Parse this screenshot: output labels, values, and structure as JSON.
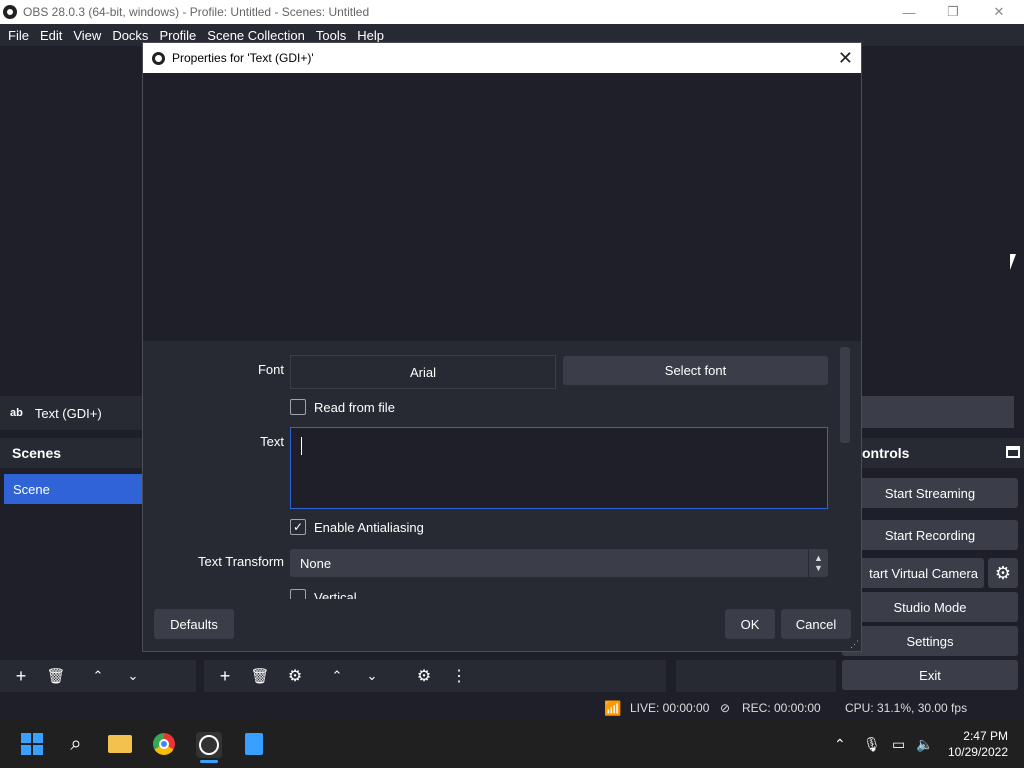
{
  "window": {
    "title": "OBS 28.0.3 (64-bit, windows) - Profile: Untitled - Scenes: Untitled",
    "minimize_icon": "—",
    "maximize_icon": "❐",
    "close_icon": "✕"
  },
  "menu": [
    "File",
    "Edit",
    "View",
    "Docks",
    "Profile",
    "Scene Collection",
    "Tools",
    "Help"
  ],
  "sources": {
    "ab_label": "ab",
    "item": "Text (GDI+)"
  },
  "scenes": {
    "header": "Scenes",
    "items": [
      "Scene"
    ]
  },
  "controls": {
    "header": "ontrols",
    "start_streaming": "Start Streaming",
    "start_recording": "Start Recording",
    "start_virtual_camera": "tart Virtual Camera",
    "studio_mode": "Studio Mode",
    "settings": "Settings",
    "exit": "Exit"
  },
  "status": {
    "live": "LIVE: 00:00:00",
    "rec": "REC: 00:00:00",
    "cpu": "CPU: 31.1%, 30.00 fps"
  },
  "dialog": {
    "title": "Properties for 'Text (GDI+)'",
    "font_label": "Font",
    "font_value": "Arial",
    "select_font": "Select font",
    "read_from_file": "Read from file",
    "read_from_file_checked": false,
    "text_label": "Text",
    "text_value": "",
    "enable_antialiasing": "Enable Antialiasing",
    "enable_antialiasing_checked": true,
    "text_transform_label": "Text Transform",
    "text_transform_value": "None",
    "vertical": "Vertical",
    "defaults": "Defaults",
    "ok": "OK",
    "cancel": "Cancel"
  },
  "taskbar": {
    "time": "2:47 PM",
    "date": "10/29/2022"
  },
  "colors": {
    "accent": "#2f63d6",
    "panel": "#272a33",
    "background": "#1e1f29",
    "button": "#3b3e48"
  }
}
